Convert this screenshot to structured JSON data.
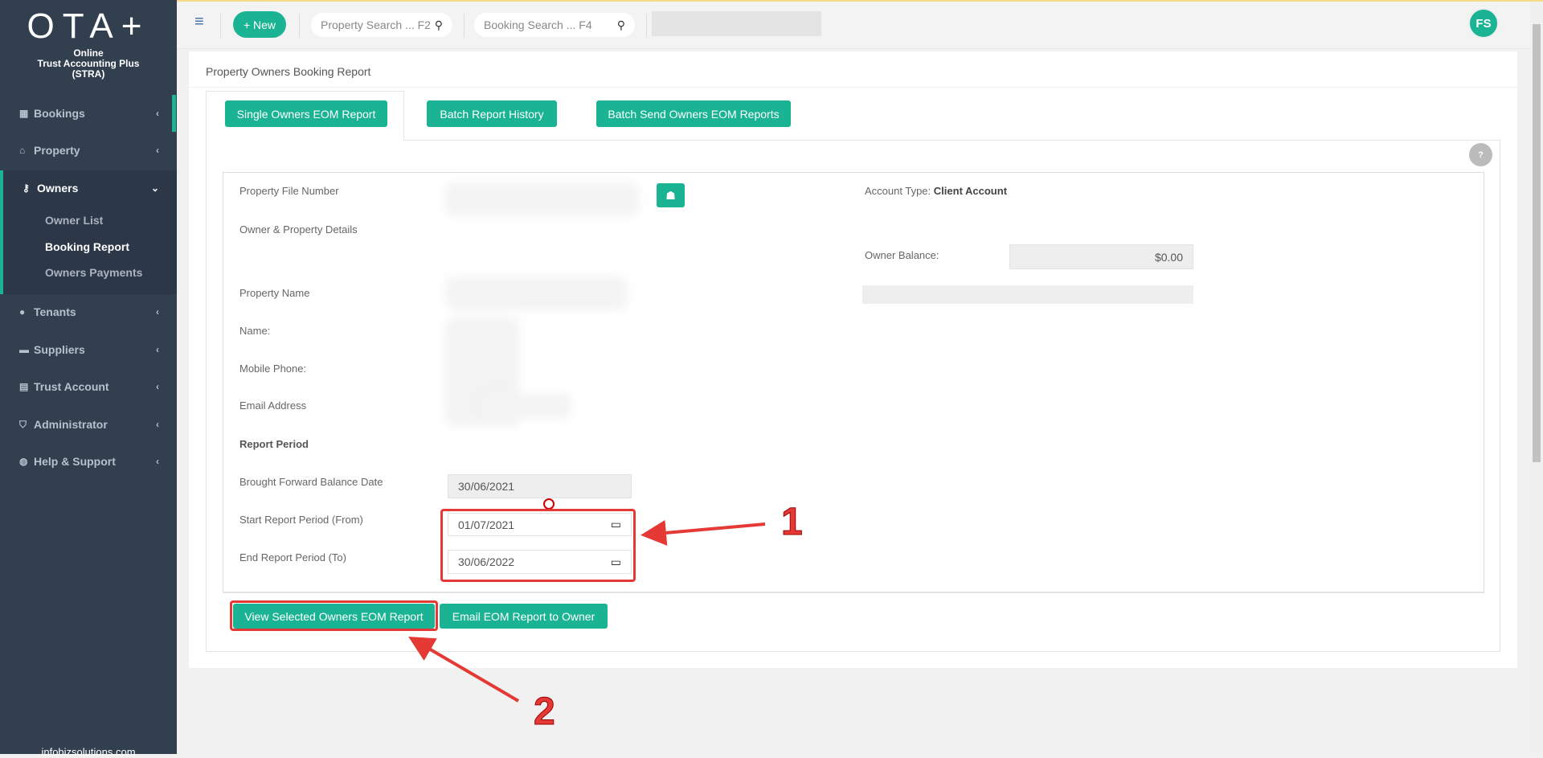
{
  "sidebar": {
    "logo": "OTA+",
    "subtitle_lines": [
      "Online",
      "Trust Accounting Plus",
      "(STRA)"
    ],
    "items": [
      {
        "label": "Bookings"
      },
      {
        "label": "Property"
      },
      {
        "label": "Owners"
      },
      {
        "label": "Tenants"
      },
      {
        "label": "Suppliers"
      },
      {
        "label": "Trust Account"
      },
      {
        "label": "Administrator"
      },
      {
        "label": "Help & Support"
      }
    ],
    "owners_sub": [
      "Owner List",
      "Booking Report",
      "Owners Payments"
    ],
    "footer": "infobizsolutions.com"
  },
  "topbar": {
    "new_label": "+ New",
    "property_search": "Property Search ... F2",
    "booking_search": "Booking Search ... F4",
    "avatar": "FS"
  },
  "page": {
    "title": "Property Owners Booking Report",
    "tabs": [
      "Single Owners EOM Report",
      "Batch Report History",
      "Batch Send Owners EOM Reports"
    ],
    "help": "?",
    "labels": {
      "file_number": "Property File Number",
      "owner_details": "Owner & Property Details",
      "property_name": "Property Name",
      "name": "Name:",
      "mobile": "Mobile Phone:",
      "email": "Email Address",
      "report_period": "Report Period",
      "bf_date": "Brought Forward Balance Date",
      "start": "Start Report Period (From)",
      "end": "End Report Period (To)"
    },
    "account_type_label": "Account Type:",
    "account_type": "Client Account",
    "owner_balance_label": "Owner Balance:",
    "owner_balance": "$0.00",
    "bf_date": "30/06/2021",
    "start_date": "01/07/2021",
    "end_date": "30/06/2022",
    "view_button": "View Selected Owners EOM Report",
    "email_button": "Email EOM Report to Owner"
  },
  "annotations": {
    "one": "1",
    "two": "2",
    "color": "#e53935"
  },
  "colors": {
    "accent": "#1ab394",
    "sidebar": "#323f4f"
  }
}
